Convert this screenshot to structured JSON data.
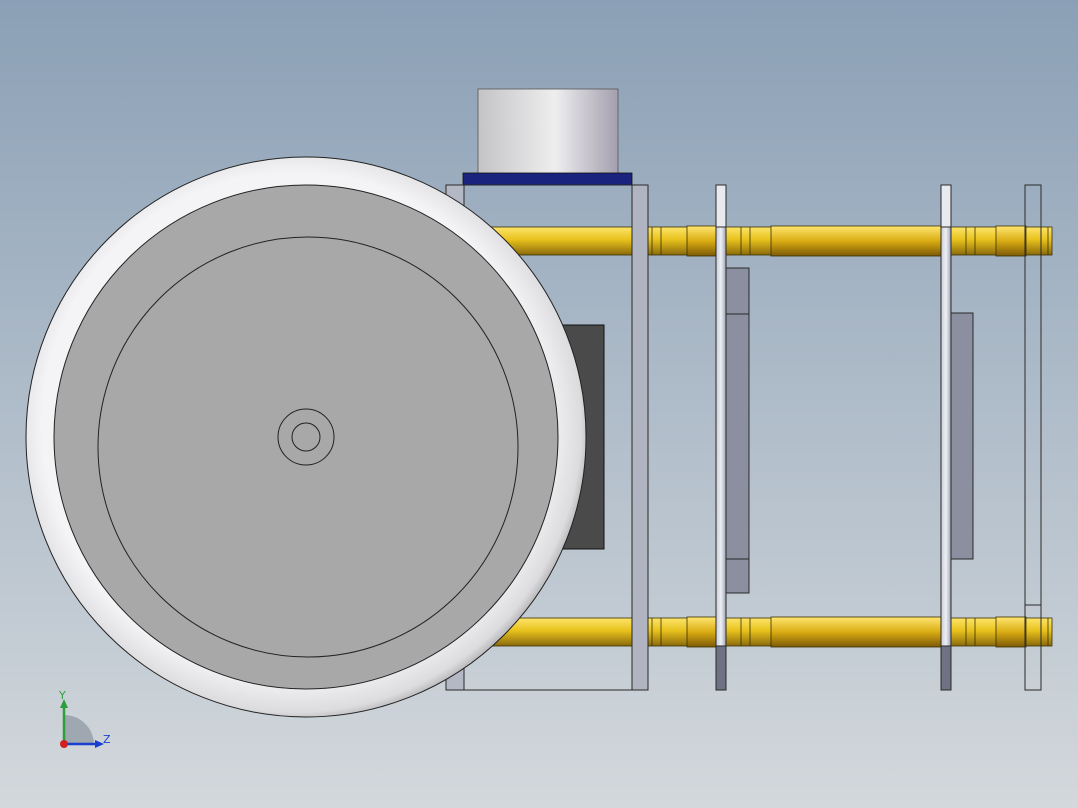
{
  "viewport": {
    "background_top": "#8ba0b6",
    "background_bottom": "#d3d8dc"
  },
  "model": {
    "colors": {
      "wheel_rim": "#ffffff",
      "wheel_face": "#a8a8a8",
      "motor_body": "#4a4a4a",
      "plate": "#a9adb8",
      "plate_dark": "#7c7f8e",
      "standoff": "#f0c830",
      "standoff_dark": "#8c6b10",
      "cap_top": "#d8d8da",
      "cap_band": "#1a237e",
      "edge": "#1a1a1a"
    }
  },
  "triad": {
    "y_label": "Y",
    "z_label": "Z",
    "colors": {
      "y": "#2e9e3a",
      "z": "#1a3fd0",
      "x": "#d02020"
    }
  }
}
